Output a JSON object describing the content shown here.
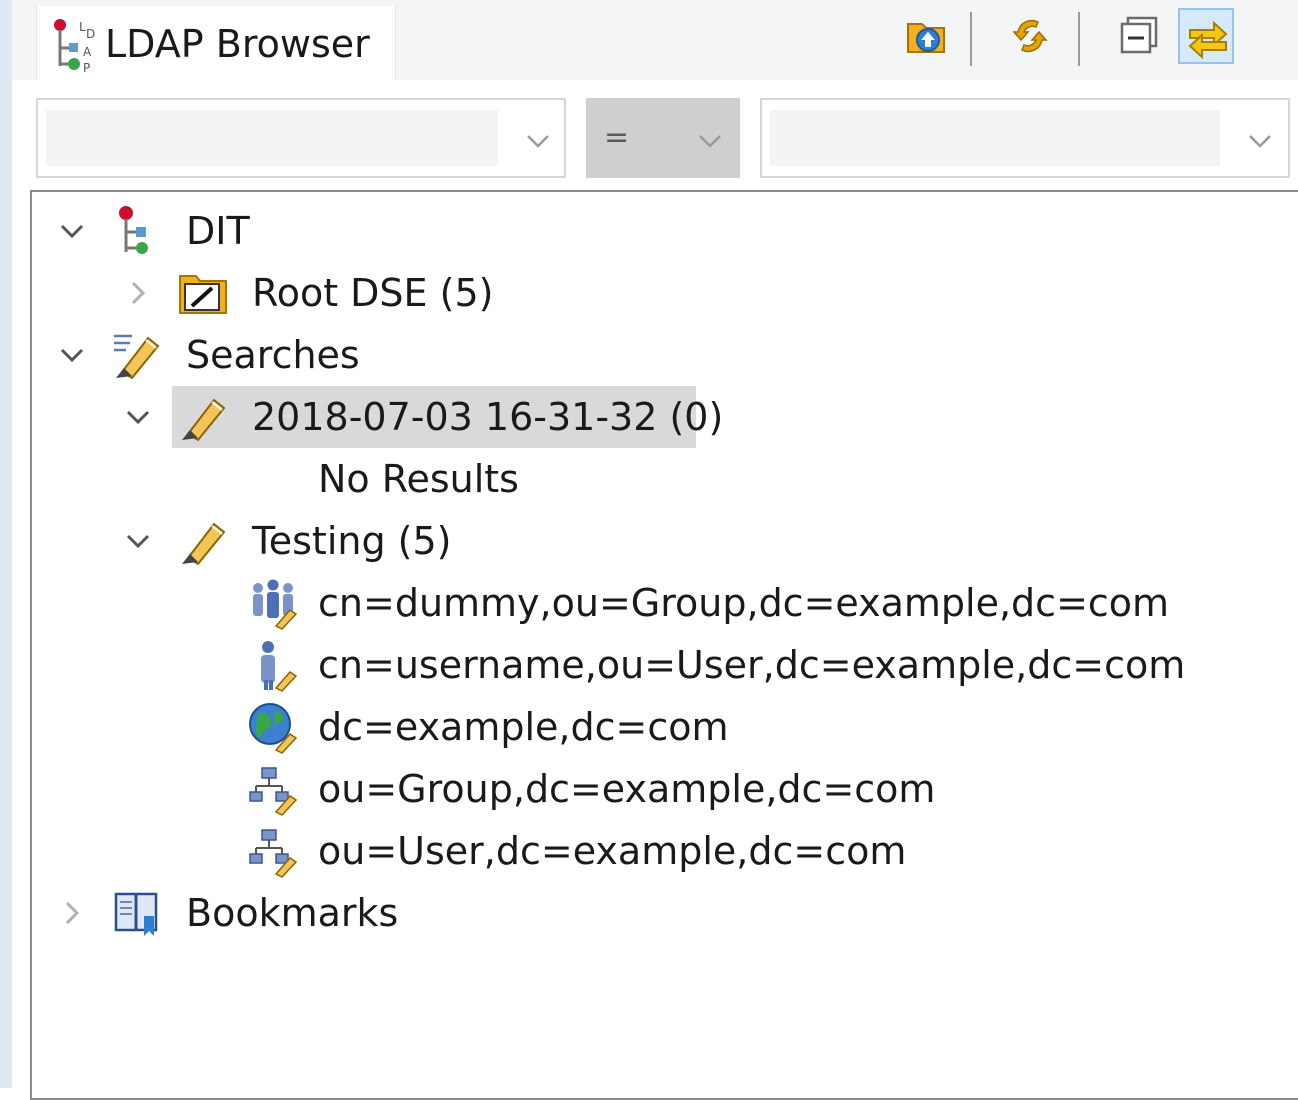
{
  "view": {
    "title": "LDAP Browser",
    "icon": "ldap-browser-icon"
  },
  "toolbar": {
    "buttons": [
      {
        "name": "up-icon",
        "label": "Up"
      },
      {
        "name": "refresh-icon",
        "label": "Refresh"
      },
      {
        "name": "collapse-all-icon",
        "label": "Collapse All"
      },
      {
        "name": "link-with-editor-icon",
        "label": "Link with Editor",
        "active": true
      }
    ]
  },
  "quick_search": {
    "attribute_value": "",
    "operator_value": "=",
    "filter_value": ""
  },
  "tree": {
    "nodes": [
      {
        "label": "DIT",
        "icon": "dit-icon",
        "state": "expanded",
        "depth": 0
      },
      {
        "label": "Root DSE (5)",
        "icon": "root-dse-folder-icon",
        "state": "collapsed",
        "depth": 1
      },
      {
        "label": "Searches",
        "icon": "searches-icon",
        "state": "expanded",
        "depth": 0
      },
      {
        "label": "2018-07-03 16-31-32 (0)",
        "icon": "search-icon",
        "state": "expanded",
        "depth": 1,
        "selected": true
      },
      {
        "label": "No Results",
        "icon": "",
        "state": "leaf",
        "depth": 2
      },
      {
        "label": "Testing (5)",
        "icon": "search-icon",
        "state": "expanded",
        "depth": 1
      },
      {
        "label": "cn=dummy,ou=Group,dc=example,dc=com",
        "icon": "group-entry-icon",
        "state": "leaf",
        "depth": 2
      },
      {
        "label": "cn=username,ou=User,dc=example,dc=com",
        "icon": "person-entry-icon",
        "state": "leaf",
        "depth": 2
      },
      {
        "label": "dc=example,dc=com",
        "icon": "domain-entry-icon",
        "state": "leaf",
        "depth": 2
      },
      {
        "label": "ou=Group,dc=example,dc=com",
        "icon": "org-unit-entry-icon",
        "state": "leaf",
        "depth": 2
      },
      {
        "label": "ou=User,dc=example,dc=com",
        "icon": "org-unit-entry-icon",
        "state": "leaf",
        "depth": 2
      },
      {
        "label": "Bookmarks",
        "icon": "bookmarks-icon",
        "state": "collapsed",
        "depth": 0
      }
    ]
  },
  "colors": {
    "selection": "#d9d9d9",
    "active_button": "#d6e9fb",
    "accent_folder": "#f2b01e"
  }
}
